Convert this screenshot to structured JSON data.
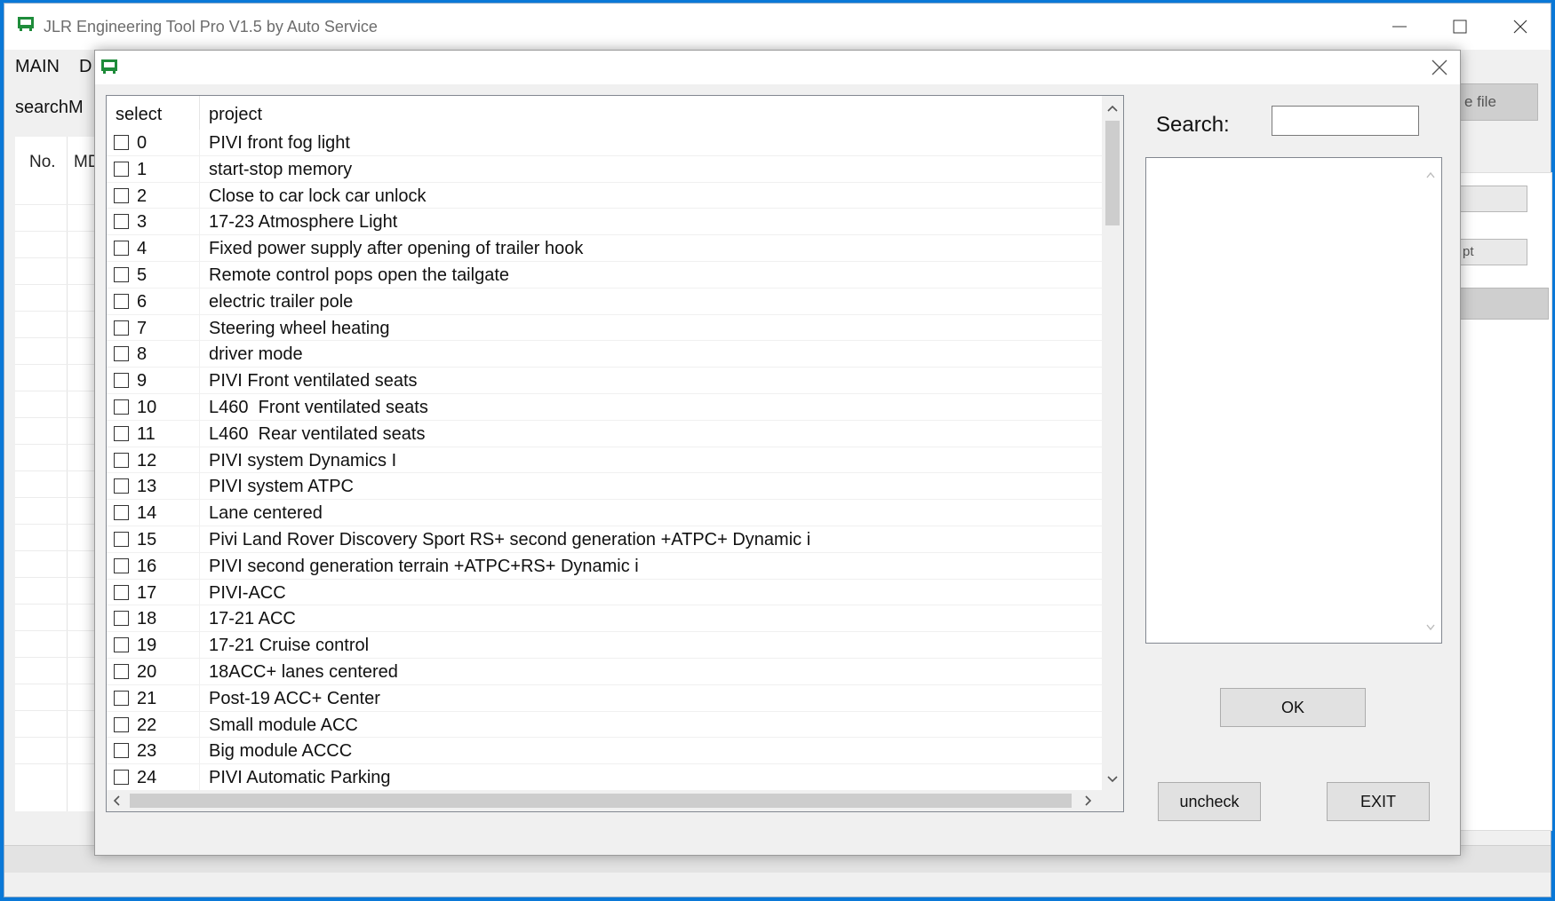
{
  "main_window": {
    "title": "JLR Engineering Tool Pro V1.5 by Auto Service",
    "menu": [
      "MAIN",
      "D"
    ],
    "search_label": "searchM",
    "grid_headers": [
      "No.",
      "MD"
    ],
    "background_buttons": [
      "e file",
      "pt"
    ]
  },
  "dialog": {
    "list": {
      "columns": [
        "select",
        "project"
      ],
      "rows": [
        {
          "num": "0",
          "project": "PIVI front fog light"
        },
        {
          "num": "1",
          "project": "start-stop memory"
        },
        {
          "num": "2",
          "project": "Close to car lock car unlock"
        },
        {
          "num": "3",
          "project": "17-23 Atmosphere Light"
        },
        {
          "num": "4",
          "project": "Fixed power supply after opening of trailer hook"
        },
        {
          "num": "5",
          "project": "Remote control pops open the tailgate"
        },
        {
          "num": "6",
          "project": "electric trailer pole"
        },
        {
          "num": "7",
          "project": "Steering wheel heating"
        },
        {
          "num": "8",
          "project": "driver mode"
        },
        {
          "num": "9",
          "project": "PIVI Front ventilated seats"
        },
        {
          "num": "10",
          "project": "L460  Front ventilated seats"
        },
        {
          "num": "11",
          "project": "L460  Rear ventilated seats"
        },
        {
          "num": "12",
          "project": "PIVI system Dynamics I"
        },
        {
          "num": "13",
          "project": "PIVI system ATPC"
        },
        {
          "num": "14",
          "project": "Lane centered"
        },
        {
          "num": "15",
          "project": "Pivi Land Rover Discovery Sport RS+ second generation +ATPC+ Dynamic i"
        },
        {
          "num": "16",
          "project": "PIVI second generation terrain +ATPC+RS+ Dynamic i"
        },
        {
          "num": "17",
          "project": "PIVI-ACC"
        },
        {
          "num": "18",
          "project": "17-21 ACC"
        },
        {
          "num": "19",
          "project": "17-21 Cruise control"
        },
        {
          "num": "20",
          "project": "18ACC+ lanes centered"
        },
        {
          "num": "21",
          "project": "Post-19 ACC+ Center"
        },
        {
          "num": "22",
          "project": "Small module ACC"
        },
        {
          "num": "23",
          "project": "Big module ACCC"
        },
        {
          "num": "24",
          "project": "PIVI Automatic Parking"
        }
      ]
    },
    "search_label": "Search:",
    "search_value": "",
    "ok_label": "OK",
    "uncheck_label": "uncheck",
    "exit_label": "EXIT"
  },
  "colors": {
    "desktop": "#0a78d7",
    "app_icon": "#1e8c3a"
  },
  "icons": {
    "app": "app-logo-icon",
    "minimize": "minimize-icon",
    "maximize": "maximize-icon",
    "close": "close-icon"
  }
}
